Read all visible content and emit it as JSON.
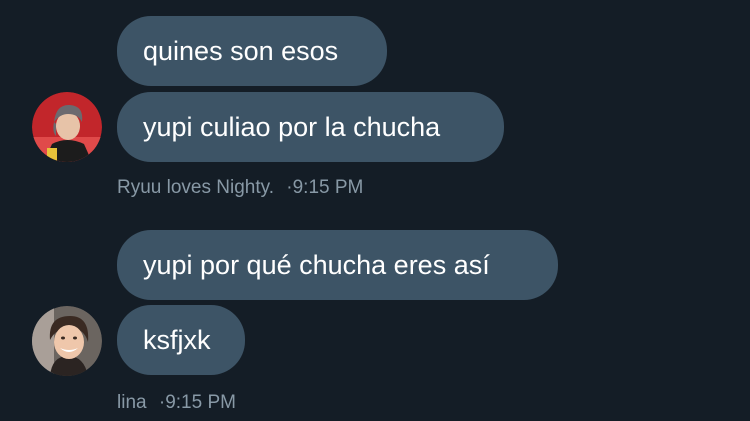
{
  "conversation": {
    "groups": [
      {
        "sender": "Ryuu loves Nighty.",
        "time": "9:15 PM",
        "avatar": "user-avatar-red",
        "messages": [
          "quines son esos",
          "yupi culiao por la chucha"
        ]
      },
      {
        "sender": "lina",
        "time": "9:15 PM",
        "avatar": "user-avatar-smiling",
        "messages": [
          "yupi por qué chucha eres así",
          "ksfjxk"
        ]
      }
    ]
  },
  "colors": {
    "background": "#141d26",
    "bubble": "#3d5466",
    "bubble_text": "#ffffff",
    "meta_text": "#8899a6"
  }
}
